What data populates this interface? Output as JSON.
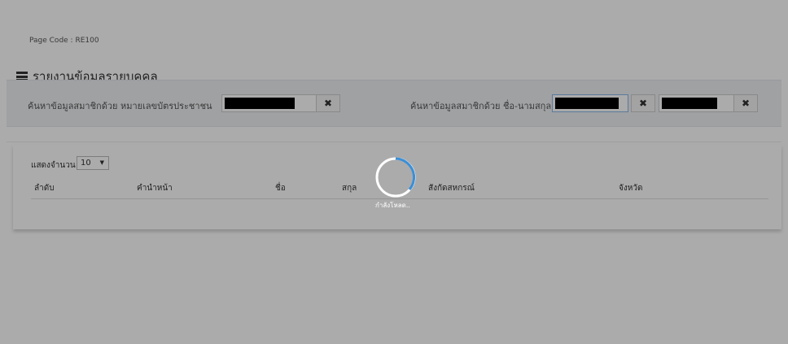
{
  "page_code": "Page Code : RE100",
  "section_title": "รายงานข้อมูลรายบุคคล",
  "search": {
    "id_label": "ค้นหาข้อมูลสมาชิกด้วย หมายเลขบัตรประชาชน",
    "name_label": "ค้นหาข้อมูลสมาชิกด้วย ชื่อ-นามสกุล",
    "clear_symbol": "✖"
  },
  "table": {
    "length_label": "แสดงจำนวน",
    "length_value": "10",
    "columns": [
      "ลำดับ",
      "คำนำหน้า",
      "ชื่อ",
      "สกุล",
      "สังกัดสหกรณ์",
      "จังหวัด"
    ]
  },
  "loading": {
    "text": "กำลังโหลด..",
    "accent": "#3a8fd8"
  }
}
